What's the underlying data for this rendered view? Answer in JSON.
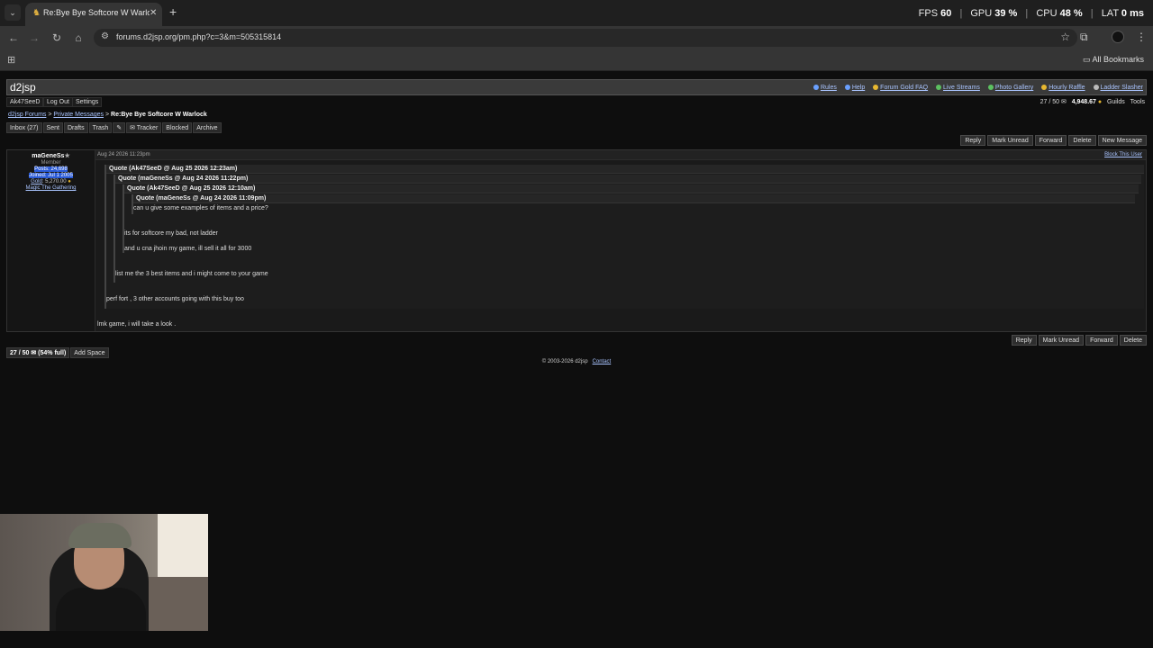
{
  "browser": {
    "tab_title": "Re:Bye Bye Softcore W Warlock",
    "new_tab": "+",
    "url": "forums.d2jsp.org/pm.php?c=3&m=505315814",
    "bookmarks_label": "All Bookmarks",
    "perf": {
      "fps_label": "FPS",
      "fps": "60",
      "gpu_label": "GPU",
      "gpu": "39 %",
      "cpu_label": "CPU",
      "cpu": "48 %",
      "lat_label": "LAT",
      "lat": "0 ms"
    }
  },
  "site": {
    "logo": "d2jsp",
    "top_links": [
      "Rules",
      "Help",
      "Forum Gold FAQ",
      "Live Streams",
      "Photo Gallery",
      "Hourly Raffle",
      "Ladder Slasher"
    ],
    "user_links": [
      "Ak47SeeD",
      "Log Out",
      "Settings"
    ],
    "pm_count": "27 / 50",
    "gold": "4,948.67",
    "guilds": "Guilds",
    "tools": "Tools"
  },
  "breadcrumb": {
    "forums": "d2jsp Forums",
    "sep": ">",
    "pm": "Private Messages",
    "current": "Re:Bye Bye Softcore W Warlock"
  },
  "pm_tabs": [
    "Inbox (27)",
    "Sent",
    "Drafts",
    "Trash",
    "✎",
    "✉ Tracker",
    "Blocked",
    "Archive"
  ],
  "actions_top": [
    "Reply",
    "Mark Unread",
    "Forward",
    "Delete",
    "New Message"
  ],
  "actions_bottom": [
    "Reply",
    "Mark Unread",
    "Forward",
    "Delete"
  ],
  "message": {
    "author": "maGeneSs",
    "star": "★",
    "role": "Member",
    "posts": "Posts: 24,698",
    "joined": "Joined: Jul 1 2005",
    "gold_label": "Gold",
    "gold_value": ": 5,270.00",
    "guild": "Magic The Gathering",
    "date": "Aug 24 2026 11:23pm",
    "block_user": "Block This User",
    "quote1_head": "Quote (Ak47SeeD @ Aug 25 2026 12:23am)",
    "quote2_head": "Quote (maGeneSs @ Aug 24 2026 11:22pm)",
    "quote3_head": "Quote (Ak47SeeD @ Aug 25 2026 12:10am)",
    "quote4_head": "Quote (maGeneSs @ Aug 24 2026 11:09pm)",
    "quote4_text": "can u give some examples of items and a price?",
    "quote3_text1": "its for softcore my bad, not ladder",
    "quote3_text2": "and u cna jhoin my game, ill sell it all for 3000",
    "quote2_text": "list me the 3 best items and i might come to your game",
    "quote1_text": "perf fort , 3 other accounts going with this buy too",
    "body": "lmk game, i will take a look ."
  },
  "footer": {
    "capacity": "27 / 50 ✉ (54% full)",
    "add_space": "Add Space",
    "copyright": "© 2003-2026 d2jsp",
    "contact": "Contact"
  },
  "colors": {
    "link": "#a9c4ff",
    "header_bg": "#3a3a3a",
    "page_bg": "#0e0e0e"
  }
}
